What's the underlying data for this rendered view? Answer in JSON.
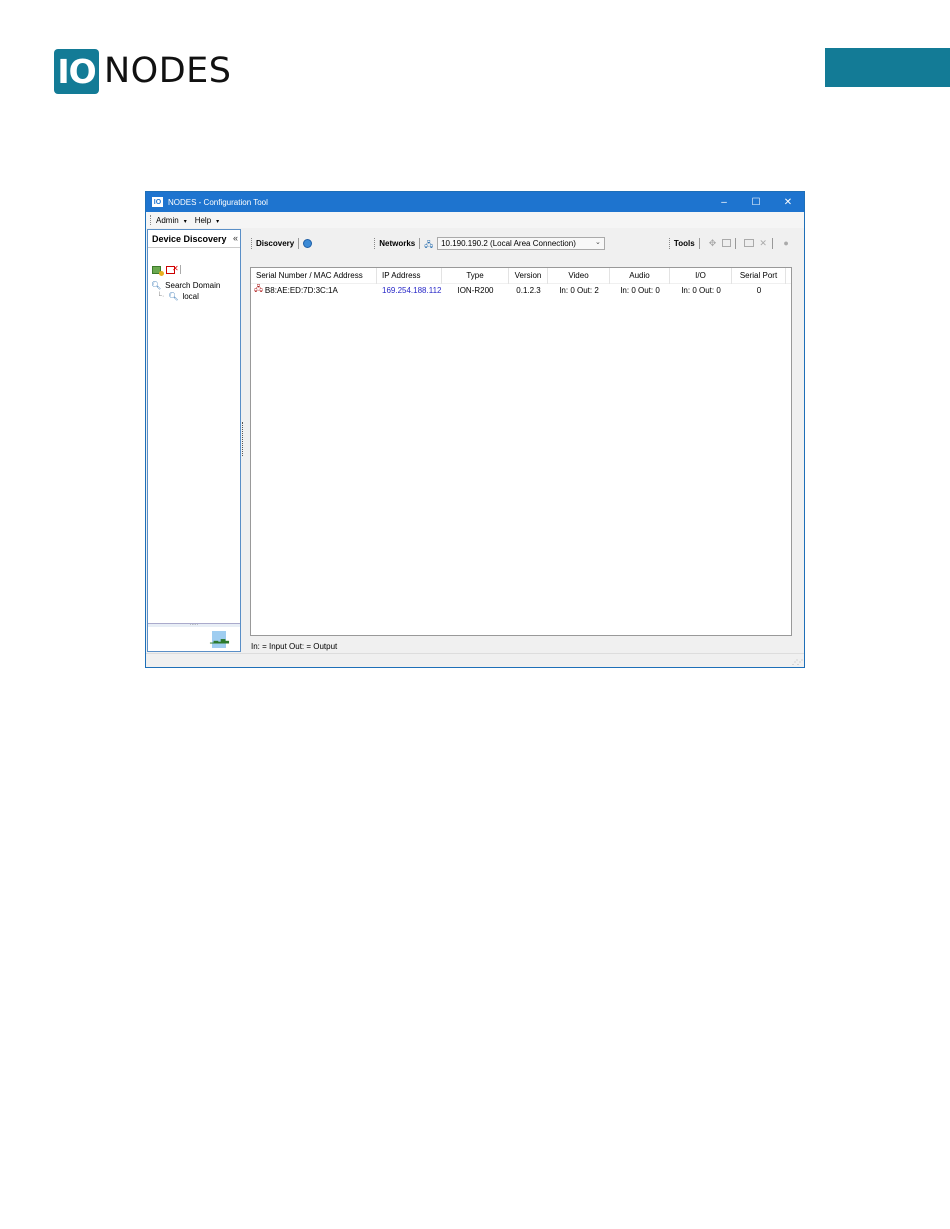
{
  "document": {
    "logo_mark": "IO",
    "logo_word": "NODES",
    "accent_color": "#137b96"
  },
  "window": {
    "icon_text": "IO",
    "title": "NODES -  Configuration Tool",
    "controls": {
      "minimize": "–",
      "maximize": "☐",
      "close": "✕"
    },
    "title_color": "#1e74cf"
  },
  "menu": {
    "items": [
      {
        "label": "Admin"
      },
      {
        "label": "Help"
      }
    ]
  },
  "left_pane": {
    "title": "Device Discovery",
    "collapse_glyph": "«",
    "tree": {
      "root": "Search Domain",
      "child": "local"
    }
  },
  "toolbar": {
    "discovery_label": "Discovery",
    "networks_label": "Networks",
    "network_selected": "10.190.190.2 (Local Area Connection)",
    "tools_label": "Tools"
  },
  "table": {
    "headers": {
      "serial": "Serial Number / MAC Address",
      "ip": "IP Address",
      "type": "Type",
      "version": "Version",
      "video": "Video",
      "audio": "Audio",
      "io": "I/O",
      "serial_port": "Serial Port"
    },
    "rows": [
      {
        "serial": "B8:AE:ED:7D:3C:1A",
        "ip": "169.254.188.112",
        "type": "ION-R200",
        "version": "0.1.2.3",
        "video": "In: 0   Out: 2",
        "audio": "In: 0   Out: 0",
        "io": "In: 0   Out: 0",
        "serial_port": "0"
      }
    ]
  },
  "legend": "In: = Input   Out: = Output"
}
